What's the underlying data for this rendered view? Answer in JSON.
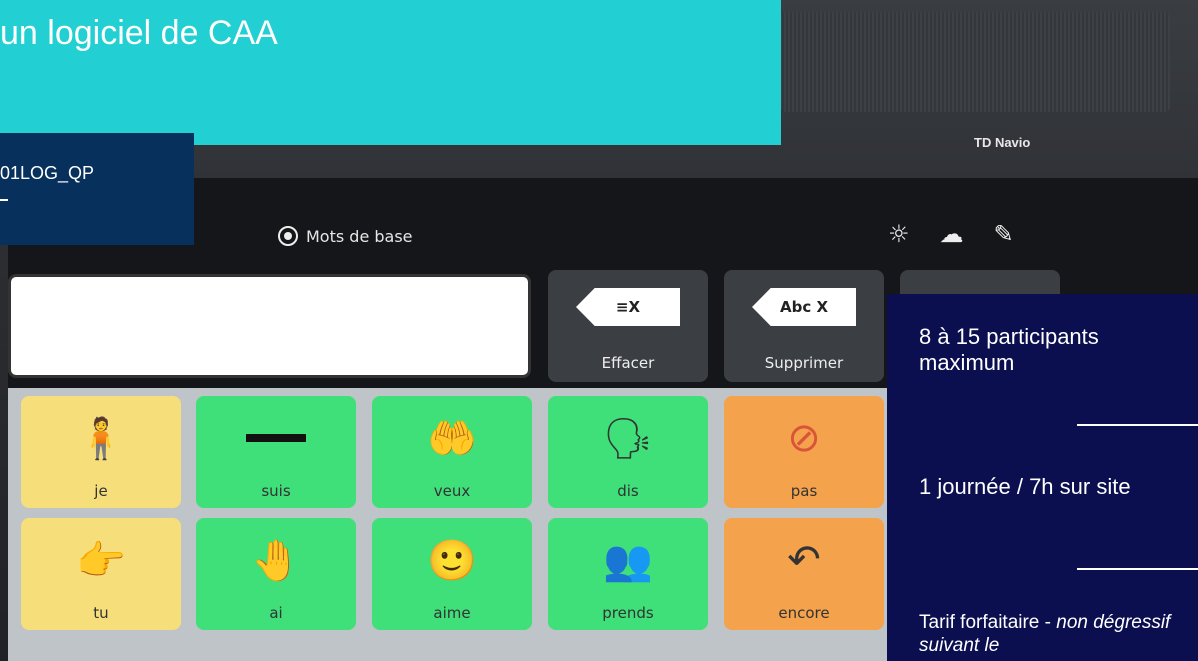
{
  "banner": {
    "title": "un logiciel de CAA",
    "code": "01LOG_QP"
  },
  "device": {
    "brand": "TD Navio",
    "page_name": "Mots de base",
    "actions": [
      {
        "label": "Effacer",
        "glyph": "≡X"
      },
      {
        "label": "Supprimer",
        "glyph": "Abc X"
      }
    ]
  },
  "grid": {
    "cells": [
      {
        "label": "je",
        "color": "#f6de7b",
        "icon": "person-self-icon"
      },
      {
        "label": "suis",
        "color": "#3fdf7a",
        "icon": "dash-icon"
      },
      {
        "label": "veux",
        "color": "#3fdf7a",
        "icon": "want-hands-icon"
      },
      {
        "label": "dis",
        "color": "#3fdf7a",
        "icon": "speaking-people-icon"
      },
      {
        "label": "pas",
        "color": "#f4a24c",
        "icon": "forbidden-icon"
      },
      {
        "label": "tu",
        "color": "#f6de7b",
        "icon": "pointing-hand-icon"
      },
      {
        "label": "ai",
        "color": "#3fdf7a",
        "icon": "hand-holding-icon"
      },
      {
        "label": "aime",
        "color": "#3fdf7a",
        "icon": "happy-face-icon"
      },
      {
        "label": "prends",
        "color": "#3fdf7a",
        "icon": "taking-people-icon"
      },
      {
        "label": "encore",
        "color": "#f4a24c",
        "icon": "again-arrows-icon"
      }
    ]
  },
  "info": {
    "participants": "8 à 15 participants maximum",
    "duration": "1 journée / 7h sur site",
    "tarif_prefix": "Tarif forfaitaire - ",
    "tarif_italic": "non dégressif suivant le"
  }
}
